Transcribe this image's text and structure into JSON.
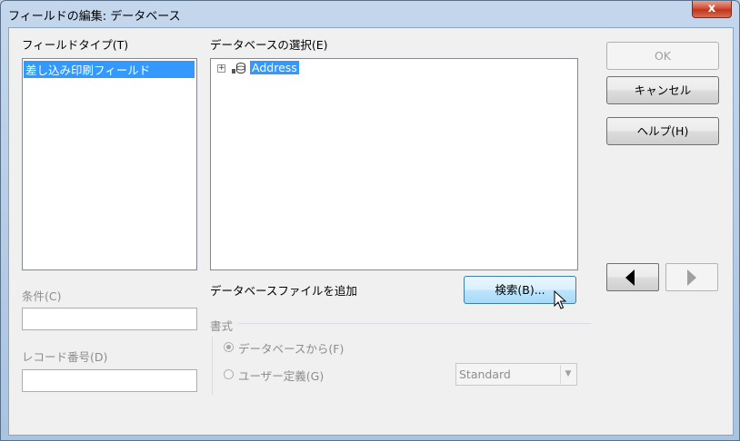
{
  "window": {
    "title": "フィールドの編集: データベース",
    "close_glyph": "x"
  },
  "field_type": {
    "label": "フィールドタイプ(T)",
    "items": [
      "差し込み印刷フィールド"
    ]
  },
  "db_select": {
    "label": "データベースの選択(E)",
    "tree": [
      {
        "expander": "+",
        "icon": "database-icon",
        "label": "Address"
      }
    ]
  },
  "condition": {
    "label": "条件(C)",
    "value": ""
  },
  "record_number": {
    "label": "レコード番号(D)",
    "value": ""
  },
  "add_db_file": {
    "label": "データベースファイルを追加",
    "browse_button": "検索(B)..."
  },
  "format": {
    "label": "書式",
    "radio_from_db": "データベースから(F)",
    "radio_user_defined": "ユーザー定義(G)",
    "combo_value": "Standard"
  },
  "buttons": {
    "ok": "OK",
    "cancel": "キャンセル",
    "help": "ヘルプ(H)"
  },
  "colors": {
    "selection": "#3399ff",
    "dialog_bg": "#f0f0f0",
    "disabled_text": "#8d8d8d"
  }
}
